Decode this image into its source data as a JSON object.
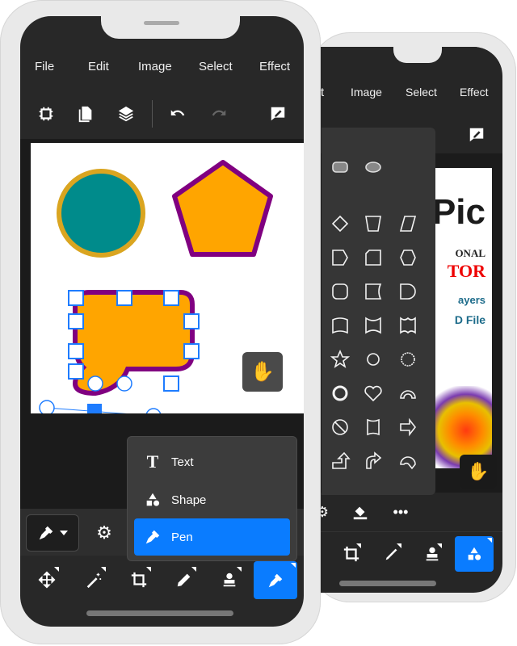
{
  "front": {
    "menu": [
      "File",
      "Edit",
      "Image",
      "Select",
      "Effect"
    ],
    "toolbar_icons": [
      "chip-icon",
      "document-icon",
      "layers-icon",
      "undo-icon",
      "redo-icon",
      "annotate-icon"
    ],
    "canvas": {
      "circle_fill": "#008b8b",
      "circle_stroke": "#daa520",
      "pentagon_fill": "#ffa500",
      "pentagon_stroke": "#800080",
      "rect_fill": "#ffa500",
      "rect_stroke": "#800080",
      "selection_color": "#1e7cff"
    },
    "popup": {
      "items": [
        {
          "label": "Text",
          "icon": "text-icon"
        },
        {
          "label": "Shape",
          "icon": "shape-icon"
        },
        {
          "label": "Pen",
          "icon": "pen-icon",
          "selected": true
        }
      ]
    },
    "bottom_tools": [
      "move-icon",
      "magic-wand-icon",
      "crop-icon",
      "pencil-icon",
      "stamp-icon",
      "pen-icon"
    ],
    "active_tool": "pen",
    "accent": "#0a7cff"
  },
  "back": {
    "menu": [
      "t",
      "Image",
      "Select",
      "Effect"
    ],
    "canvas_text": {
      "line1": "Pic",
      "line2": "ONAL",
      "line3": "TOR",
      "line4": "ayers",
      "line5": "D File"
    },
    "shapes": [
      "rounded-rect",
      "ellipse",
      "diamond",
      "trapezoid",
      "parallelogram",
      "pentagon-arrow",
      "snip-rect",
      "hexagon",
      "rounded-square",
      "concave-rect",
      "d-shape",
      "wave-flag",
      "double-wave",
      "double-wave-flag",
      "star",
      "seven-point-star",
      "gear-star",
      "ring",
      "heart",
      "arc",
      "no-symbol",
      "bracket",
      "right-arrow",
      "bent-up-arrow",
      "curved-arrow",
      "curved-arc-arrow"
    ],
    "bottom_icons": [
      "gear-icon",
      "fill-icon",
      "more-icon"
    ],
    "bottom_tools": [
      "crop-icon",
      "brush-icon",
      "stamp-icon",
      "shape-icon"
    ],
    "active_tool": "shape"
  }
}
